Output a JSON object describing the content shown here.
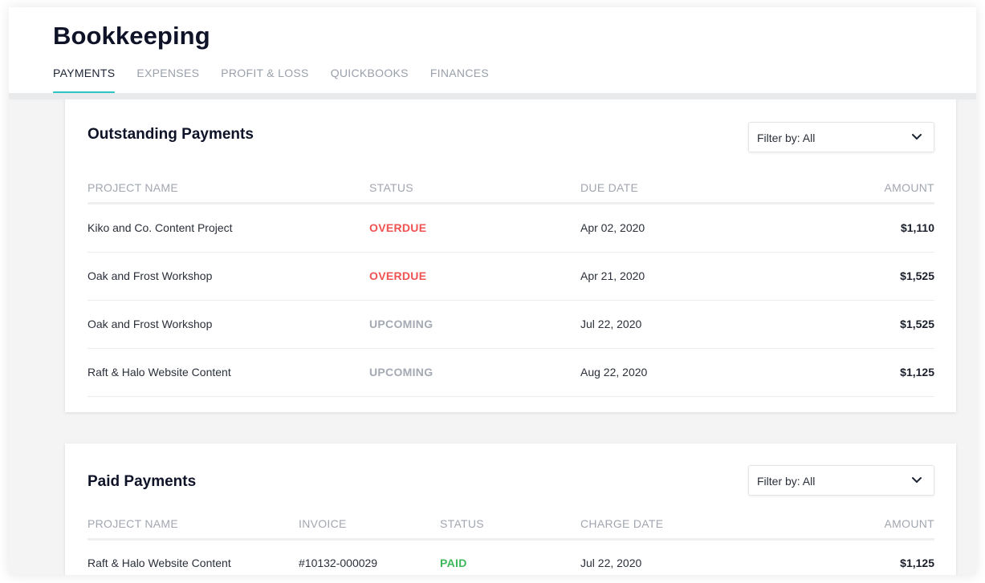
{
  "app": {
    "title": "Bookkeeping"
  },
  "tabs": [
    {
      "label": "PAYMENTS",
      "active": true
    },
    {
      "label": "EXPENSES",
      "active": false
    },
    {
      "label": "PROFIT & LOSS",
      "active": false
    },
    {
      "label": "QUICKBOOKS",
      "active": false
    },
    {
      "label": "FINANCES",
      "active": false
    }
  ],
  "colors": {
    "accent": "#2fc4c4",
    "overdue": "#f05252",
    "upcoming": "#a4a9b3",
    "paid": "#3cb85a"
  },
  "outstanding": {
    "title": "Outstanding Payments",
    "filter_label": "Filter by: All",
    "filter_icon": "chevron-down-icon",
    "columns": [
      "PROJECT NAME",
      "STATUS",
      "DUE DATE",
      "AMOUNT"
    ],
    "rows": [
      {
        "project": "Kiko and Co. Content Project",
        "status": "OVERDUE",
        "date": "Apr 02, 2020",
        "amount": "$1,110"
      },
      {
        "project": "Oak and Frost Workshop",
        "status": "OVERDUE",
        "date": "Apr 21, 2020",
        "amount": "$1,525"
      },
      {
        "project": "Oak and Frost Workshop",
        "status": "UPCOMING",
        "date": "Jul 22, 2020",
        "amount": "$1,525"
      },
      {
        "project": "Raft & Halo Website Content",
        "status": "UPCOMING",
        "date": "Aug 22, 2020",
        "amount": "$1,125"
      }
    ]
  },
  "paid": {
    "title": "Paid Payments",
    "filter_label": "Filter by: All",
    "filter_icon": "chevron-down-icon",
    "columns": [
      "PROJECT NAME",
      "INVOICE",
      "STATUS",
      "CHARGE DATE",
      "AMOUNT"
    ],
    "rows": [
      {
        "project": "Raft & Halo Website Content",
        "invoice": "#10132-000029",
        "status": "PAID",
        "date": "Jul 22, 2020",
        "amount": "$1,125"
      }
    ]
  }
}
